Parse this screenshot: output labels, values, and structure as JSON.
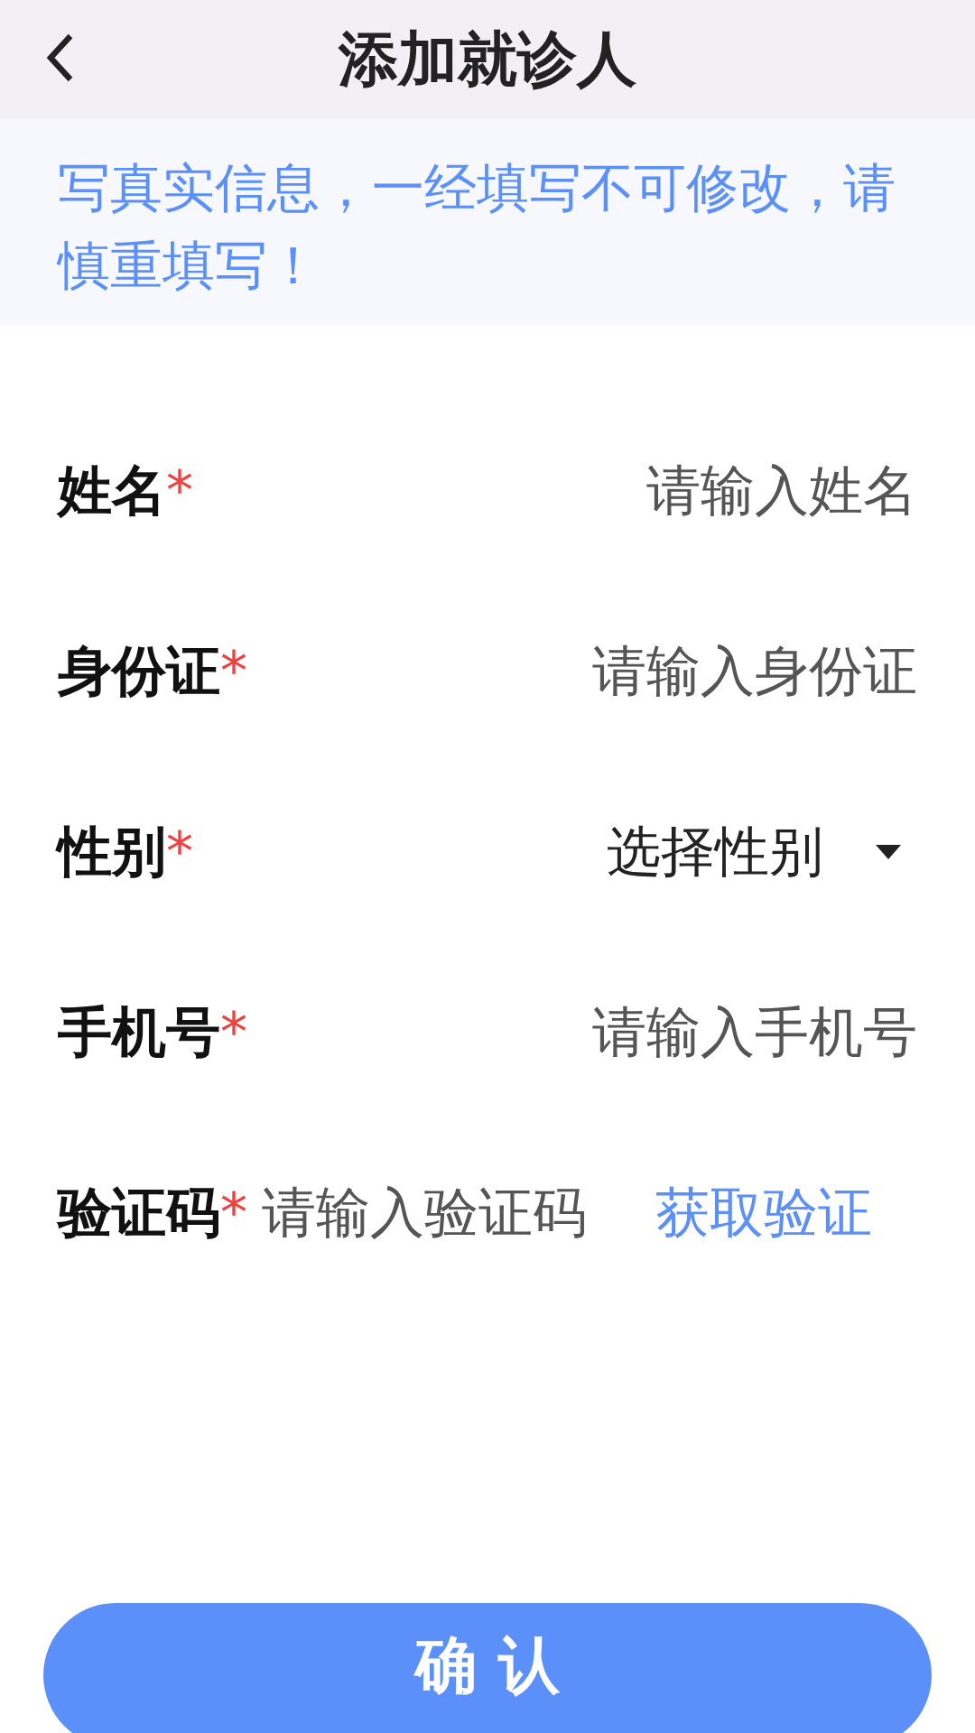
{
  "header": {
    "title": "添加就诊人"
  },
  "notice": "写真实信息，一经填写不可修改，请慎重填写！",
  "fields": [
    {
      "kind": "input",
      "label": "姓名",
      "required": "*",
      "placeholder": "请输入姓名"
    },
    {
      "kind": "input",
      "label": "身份证",
      "required": "*",
      "placeholder": "请输入身份证"
    },
    {
      "kind": "select",
      "label": "性别",
      "required": "*",
      "placeholder": "选择性别"
    },
    {
      "kind": "input",
      "label": "手机号",
      "required": "*",
      "placeholder": "请输入手机号"
    },
    {
      "kind": "code",
      "label": "验证码",
      "required": "*",
      "placeholder": "请输入验证码",
      "action": "获取验证"
    }
  ],
  "confirm_button": "确 认"
}
